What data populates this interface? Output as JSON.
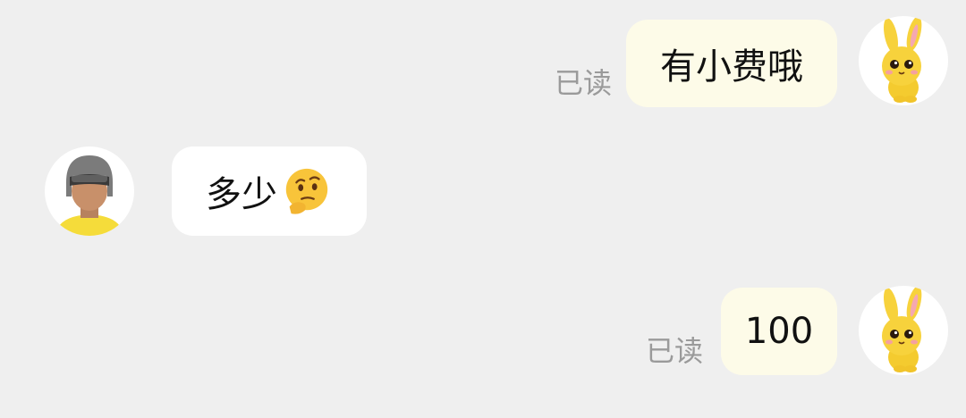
{
  "messages": [
    {
      "sender": "me",
      "text": "有小费哦",
      "status": "已读",
      "avatar": "bunny-avatar"
    },
    {
      "sender": "them",
      "text": "多少",
      "emoji": "thinking-face-emoji",
      "avatar": "rider-helmet-avatar"
    },
    {
      "sender": "me",
      "text": "100",
      "status": "已读",
      "avatar": "bunny-avatar"
    }
  ],
  "colors": {
    "background": "#efefef",
    "my_bubble": "#fdfbe8",
    "their_bubble": "#ffffff",
    "read_status": "#9a9a9a",
    "bunny_yellow": "#f7d23c",
    "rider_shirt": "#f5dc3a"
  }
}
